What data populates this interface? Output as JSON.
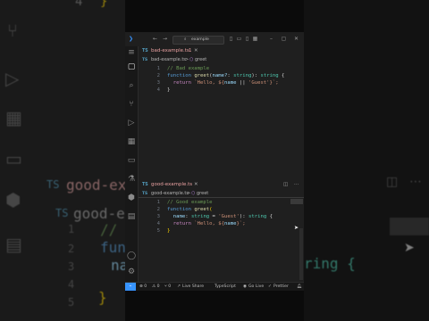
{
  "window": {
    "search_text": "example",
    "nav_back": "←",
    "nav_forward": "→"
  },
  "top_pane": {
    "tab_lang": "TS",
    "tab_label": "bad-example.ts",
    "tab_index": "1",
    "crumb_file": "bad-example.ts",
    "crumb_sep": ">",
    "crumb_symbol": "greet",
    "lines": [
      {
        "n": "1",
        "parts": [
          {
            "t": "// Bad example",
            "c": "cm"
          }
        ]
      },
      {
        "n": "2",
        "parts": [
          {
            "t": "function ",
            "c": "kw"
          },
          {
            "t": "greet",
            "c": "fn"
          },
          {
            "t": "(",
            "c": "pl"
          },
          {
            "t": "name?",
            "c": "pm"
          },
          {
            "t": ": ",
            "c": "pl"
          },
          {
            "t": "string",
            "c": "ty"
          },
          {
            "t": "): ",
            "c": "pl"
          },
          {
            "t": "string",
            "c": "ty"
          },
          {
            "t": " {",
            "c": "pl"
          }
        ]
      },
      {
        "n": "3",
        "parts": [
          {
            "t": "  return ",
            "c": "ct"
          },
          {
            "t": "`Hello, ${",
            "c": "str"
          },
          {
            "t": "name",
            "c": "pm"
          },
          {
            "t": " || ",
            "c": "pl"
          },
          {
            "t": "'Guest'",
            "c": "str"
          },
          {
            "t": "}`;",
            "c": "str"
          }
        ]
      },
      {
        "n": "4",
        "parts": [
          {
            "t": "}",
            "c": "pl"
          }
        ]
      }
    ]
  },
  "bottom_pane": {
    "tab_lang": "TS",
    "tab_label": "good-example.ts",
    "crumb_file": "good-example.ts",
    "crumb_sep": ">",
    "crumb_symbol": "greet",
    "lines": [
      {
        "n": "1",
        "parts": [
          {
            "t": "// Good example",
            "c": "cm"
          }
        ]
      },
      {
        "n": "2",
        "parts": [
          {
            "t": "function ",
            "c": "kw"
          },
          {
            "t": "greet",
            "c": "fn"
          },
          {
            "t": "(",
            "c": "br"
          }
        ]
      },
      {
        "n": "3",
        "parts": [
          {
            "t": "  name",
            "c": "pm"
          },
          {
            "t": ": ",
            "c": "pl"
          },
          {
            "t": "string",
            "c": "ty"
          },
          {
            "t": " = ",
            "c": "pl"
          },
          {
            "t": "'Guest'",
            "c": "str"
          },
          {
            "t": "): ",
            "c": "pl"
          },
          {
            "t": "string",
            "c": "ty"
          },
          {
            "t": " {",
            "c": "pl"
          }
        ]
      },
      {
        "n": "4",
        "parts": [
          {
            "t": "  return ",
            "c": "ct"
          },
          {
            "t": "`Hello, ${",
            "c": "str"
          },
          {
            "t": "name",
            "c": "pm"
          },
          {
            "t": "}`;",
            "c": "str"
          }
        ]
      },
      {
        "n": "5",
        "parts": [
          {
            "t": "}",
            "c": "br"
          }
        ]
      }
    ]
  },
  "status_bar": {
    "remote": "⌁",
    "errors": "⊗ 0",
    "warnings": "⚠ 0",
    "ports": "⑂ 0",
    "live_share": "Live Share",
    "language": "TypeScript",
    "go_live": "Go Live",
    "prettier": "Prettier"
  },
  "background": {
    "left_lines": [
      "4",
      "TS",
      "good-examp",
      "TS",
      "good-exa",
      "1",
      "2",
      "3",
      "4",
      "5",
      "// G",
      "func",
      "na"
    ],
    "right_text": "ring {"
  },
  "colors": {
    "accent": "#3794ff",
    "editor_bg": "#1f1f1f",
    "activity_bg": "#181818",
    "ts_badge": "#519aba"
  }
}
